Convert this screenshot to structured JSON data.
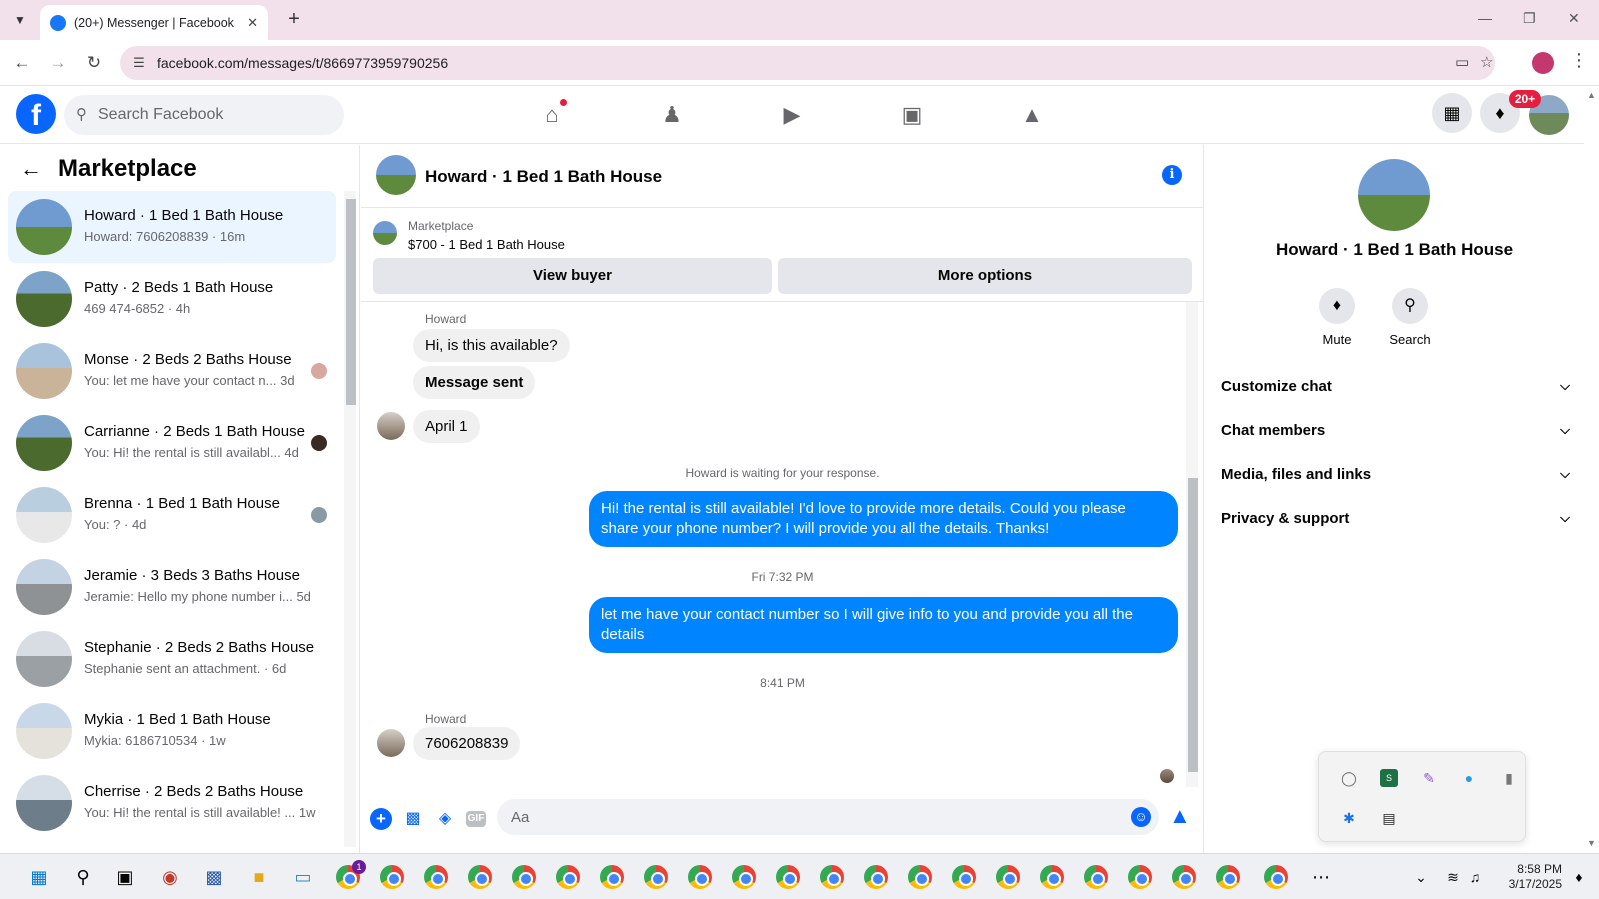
{
  "browser": {
    "tab_title": "(20+) Messenger | Facebook",
    "url": "facebook.com/messages/t/8669773959790256"
  },
  "fb": {
    "search_placeholder": "Search Facebook",
    "notif_badge": "20+"
  },
  "left": {
    "title": "Marketplace",
    "conversations": [
      {
        "title": "Howard · 1 Bed 1 Bath House",
        "preview": "Howard: 7606208839 · 16m"
      },
      {
        "title": "Patty · 2 Beds 1 Bath House",
        "preview": "469 474-6852 · 4h"
      },
      {
        "title": "Monse · 2 Beds 2 Baths House",
        "preview": "You: let me have your contact n...",
        "time": "3d"
      },
      {
        "title": "Carrianne · 2 Beds 1 Bath House",
        "preview": "You: Hi! the rental is still availabl...",
        "time": "4d"
      },
      {
        "title": "Brenna · 1 Bed 1 Bath House",
        "preview": "You: ? · 4d"
      },
      {
        "title": "Jeramie · 3 Beds 3 Baths House",
        "preview": "Jeramie: Hello my phone number i...",
        "time": "5d"
      },
      {
        "title": "Stephanie · 2 Beds 2 Baths House",
        "preview": "Stephanie sent an attachment. · 6d"
      },
      {
        "title": "Mykia · 1 Bed 1 Bath House",
        "preview": "Mykia: 6186710534 · 1w"
      },
      {
        "title": "Cherrise · 2 Beds 2 Baths House",
        "preview": "You: Hi! the rental is still available! ...",
        "time": "1w"
      }
    ]
  },
  "chat": {
    "title": "Howard · 1 Bed 1 Bath House",
    "listing_source": "Marketplace",
    "listing_desc": "$700 - 1 Bed 1 Bath House",
    "view_buyer": "View buyer",
    "more_options": "More options",
    "sender_1": "Howard",
    "msg_in_1": "Hi, is this available?",
    "msg_in_2": "Message sent",
    "msg_in_3": "April 1",
    "waiting": "Howard is waiting for your response.",
    "msg_out_1": "Hi! the rental is still available! I'd love to provide more details. Could you please share your phone number? I will provide you all the details. Thanks!",
    "time_1": "Fri 7:32 PM",
    "msg_out_2": "let me have your contact number so I will give info to you and provide you all the details",
    "time_2": "8:41 PM",
    "sender_2": "Howard",
    "msg_in_4": "7606208839",
    "composer_placeholder": "Aa"
  },
  "right": {
    "name": "Howard · 1 Bed 1 Bath House",
    "mute": "Mute",
    "search": "Search",
    "sections": [
      "Customize chat",
      "Chat members",
      "Media, files and links",
      "Privacy & support"
    ]
  },
  "taskbar": {
    "time": "8:58 PM",
    "date": "3/17/2025",
    "chrome_badge": "1"
  },
  "colors": {
    "fb_blue": "#0866ff",
    "bubble_out": "#0084ff",
    "active_row": "#ebf5ff",
    "tabstrip": "#f2e1ea"
  }
}
